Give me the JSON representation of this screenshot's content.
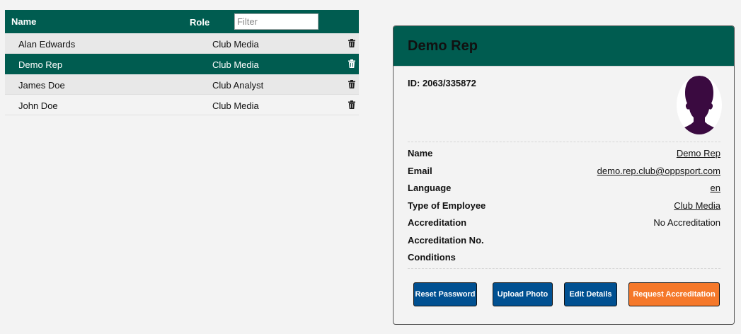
{
  "table": {
    "headers": {
      "name": "Name",
      "role": "Role"
    },
    "filter_placeholder": "Filter",
    "rows": [
      {
        "name": "Alan Edwards",
        "role": "Club Media"
      },
      {
        "name": "Demo Rep",
        "role": "Club Media"
      },
      {
        "name": "James Doe",
        "role": "Club Analyst"
      },
      {
        "name": "John Doe",
        "role": "Club Media"
      }
    ],
    "selected_index": 1
  },
  "detail": {
    "title": "Demo Rep",
    "id_text": "ID: 2063/335872",
    "fields": {
      "name_label": "Name",
      "name_value": "Demo Rep",
      "email_label": "Email",
      "email_value": "demo.rep.club@oppsport.com",
      "language_label": "Language",
      "language_value": "en",
      "type_label": "Type of Employee",
      "type_value": "Club Media",
      "accreditation_label": "Accreditation",
      "accreditation_value": "No Accreditation",
      "accreditation_no_label": "Accreditation No.",
      "conditions_label": "Conditions"
    },
    "buttons": {
      "reset_password": "Reset Password",
      "upload_photo": "Upload Photo",
      "edit_details": "Edit Details",
      "request_accreditation": "Request Accreditation"
    }
  },
  "colors": {
    "header_green": "#005c50",
    "button_blue": "#005091",
    "button_orange": "#f5782a",
    "avatar_silhouette": "#3a0a40"
  },
  "icons": {
    "delete": "trash-icon",
    "avatar": "person-silhouette-icon"
  }
}
